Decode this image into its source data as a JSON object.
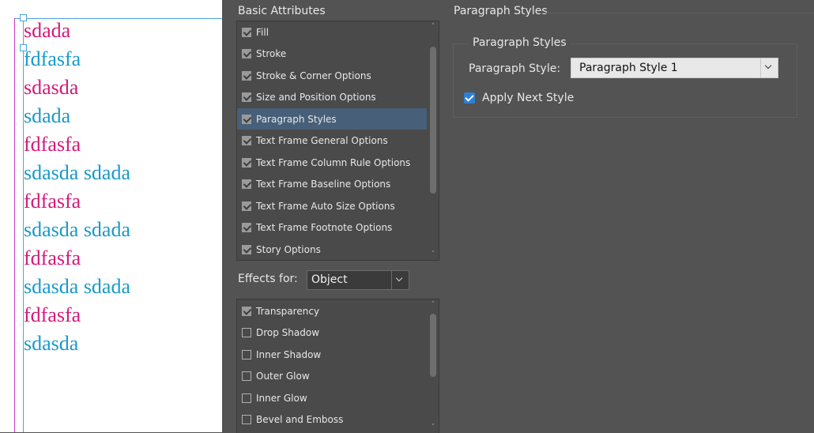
{
  "document": {
    "lines": [
      {
        "text": "sdada",
        "color": "#d4197a"
      },
      {
        "text": "fdfasfa",
        "color": "#1a9ac9"
      },
      {
        "text": "sdasda",
        "color": "#d4197a"
      },
      {
        "text": "sdada",
        "color": "#1a9ac9"
      },
      {
        "text": "fdfasfa",
        "color": "#d4197a"
      },
      {
        "text": "sdasda sdada",
        "color": "#1a9ac9"
      },
      {
        "text": "fdfasfa",
        "color": "#d4197a"
      },
      {
        "text": "sdasda sdada",
        "color": "#1a9ac9"
      },
      {
        "text": "fdfasfa",
        "color": "#d4197a"
      },
      {
        "text": "sdasda sdada",
        "color": "#1a9ac9"
      },
      {
        "text": "fdfasfa",
        "color": "#d4197a"
      },
      {
        "text": "sdasda",
        "color": "#1a9ac9"
      }
    ]
  },
  "basic_attributes": {
    "title": "Basic Attributes",
    "items": [
      {
        "label": "Fill",
        "checked": true,
        "selected": false
      },
      {
        "label": "Stroke",
        "checked": true,
        "selected": false
      },
      {
        "label": "Stroke & Corner Options",
        "checked": true,
        "selected": false
      },
      {
        "label": "Size and Position Options",
        "checked": true,
        "selected": false
      },
      {
        "label": "Paragraph Styles",
        "checked": true,
        "selected": true
      },
      {
        "label": "Text Frame General Options",
        "checked": true,
        "selected": false
      },
      {
        "label": "Text Frame Column Rule Options",
        "checked": true,
        "selected": false
      },
      {
        "label": "Text Frame Baseline Options",
        "checked": true,
        "selected": false
      },
      {
        "label": "Text Frame Auto Size Options",
        "checked": true,
        "selected": false
      },
      {
        "label": "Text Frame Footnote Options",
        "checked": true,
        "selected": false
      },
      {
        "label": "Story Options",
        "checked": true,
        "selected": false
      }
    ]
  },
  "effects": {
    "label": "Effects for:",
    "selected_value": "Object",
    "items": [
      {
        "label": "Transparency",
        "checked": true
      },
      {
        "label": "Drop Shadow",
        "checked": false
      },
      {
        "label": "Inner Shadow",
        "checked": false
      },
      {
        "label": "Outer Glow",
        "checked": false
      },
      {
        "label": "Inner Glow",
        "checked": false
      },
      {
        "label": "Bevel and Emboss",
        "checked": false
      }
    ]
  },
  "paragraph_panel": {
    "title": "Paragraph Styles",
    "group_title": "Paragraph Styles",
    "style_label": "Paragraph Style:",
    "style_value": "Paragraph Style 1",
    "apply_next_label": "Apply Next Style",
    "apply_next_checked": true
  },
  "colors": {
    "dialog_bg": "#535353",
    "selection": "#475f79",
    "checkbox_accent": "#2d7fd3"
  }
}
